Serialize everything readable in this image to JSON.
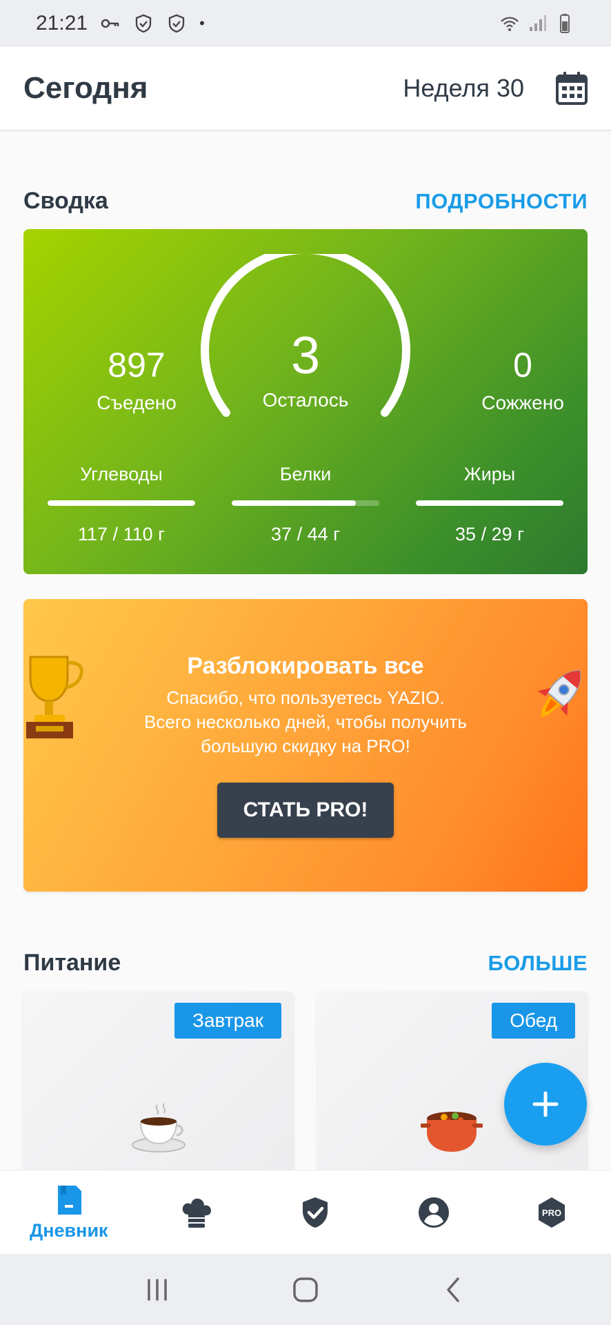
{
  "status_bar": {
    "time": "21:21",
    "dot": "•"
  },
  "header": {
    "title": "Сегодня",
    "week": "Неделя 30"
  },
  "summary": {
    "title": "Сводка",
    "details_link": "ПОДРОБНОСТИ",
    "eaten_value": "897",
    "eaten_label": "Съедено",
    "remaining_value": "3",
    "remaining_label": "Осталось",
    "burned_value": "0",
    "burned_label": "Сожжено",
    "macros": [
      {
        "name": "Углеводы",
        "value": "117 / 110 г",
        "progress": 1.0
      },
      {
        "name": "Белки",
        "value": "37 / 44 г",
        "progress": 0.84
      },
      {
        "name": "Жиры",
        "value": "35 / 29 г",
        "progress": 1.0
      }
    ]
  },
  "promo": {
    "title": "Разблокировать все",
    "line1": "Спасибо, что пользуетесь YAZIO.",
    "line2": "Всего несколько дней, чтобы получить",
    "line3": "большую скидку на PRO!",
    "button": "СТАТЬ PRO!"
  },
  "nutrition": {
    "title": "Питание",
    "more_link": "БОЛЬШЕ",
    "meals": [
      {
        "label": "Завтрак",
        "icon": "coffee-cup-icon"
      },
      {
        "label": "Обед",
        "icon": "stew-pot-icon"
      }
    ]
  },
  "bottom_nav": {
    "items": [
      {
        "label": "Дневник",
        "icon": "diary-icon",
        "active": true
      },
      {
        "label": "",
        "icon": "chef-hat-icon"
      },
      {
        "label": "",
        "icon": "shield-check-icon"
      },
      {
        "label": "",
        "icon": "profile-icon"
      },
      {
        "label": "",
        "icon": "pro-badge-icon",
        "badge_text": "PRO"
      }
    ]
  },
  "colors": {
    "accent": "#1a96e8",
    "card_green": "#6fb21d",
    "card_orange": "#ff8a2a",
    "dark_button": "#37414d"
  }
}
